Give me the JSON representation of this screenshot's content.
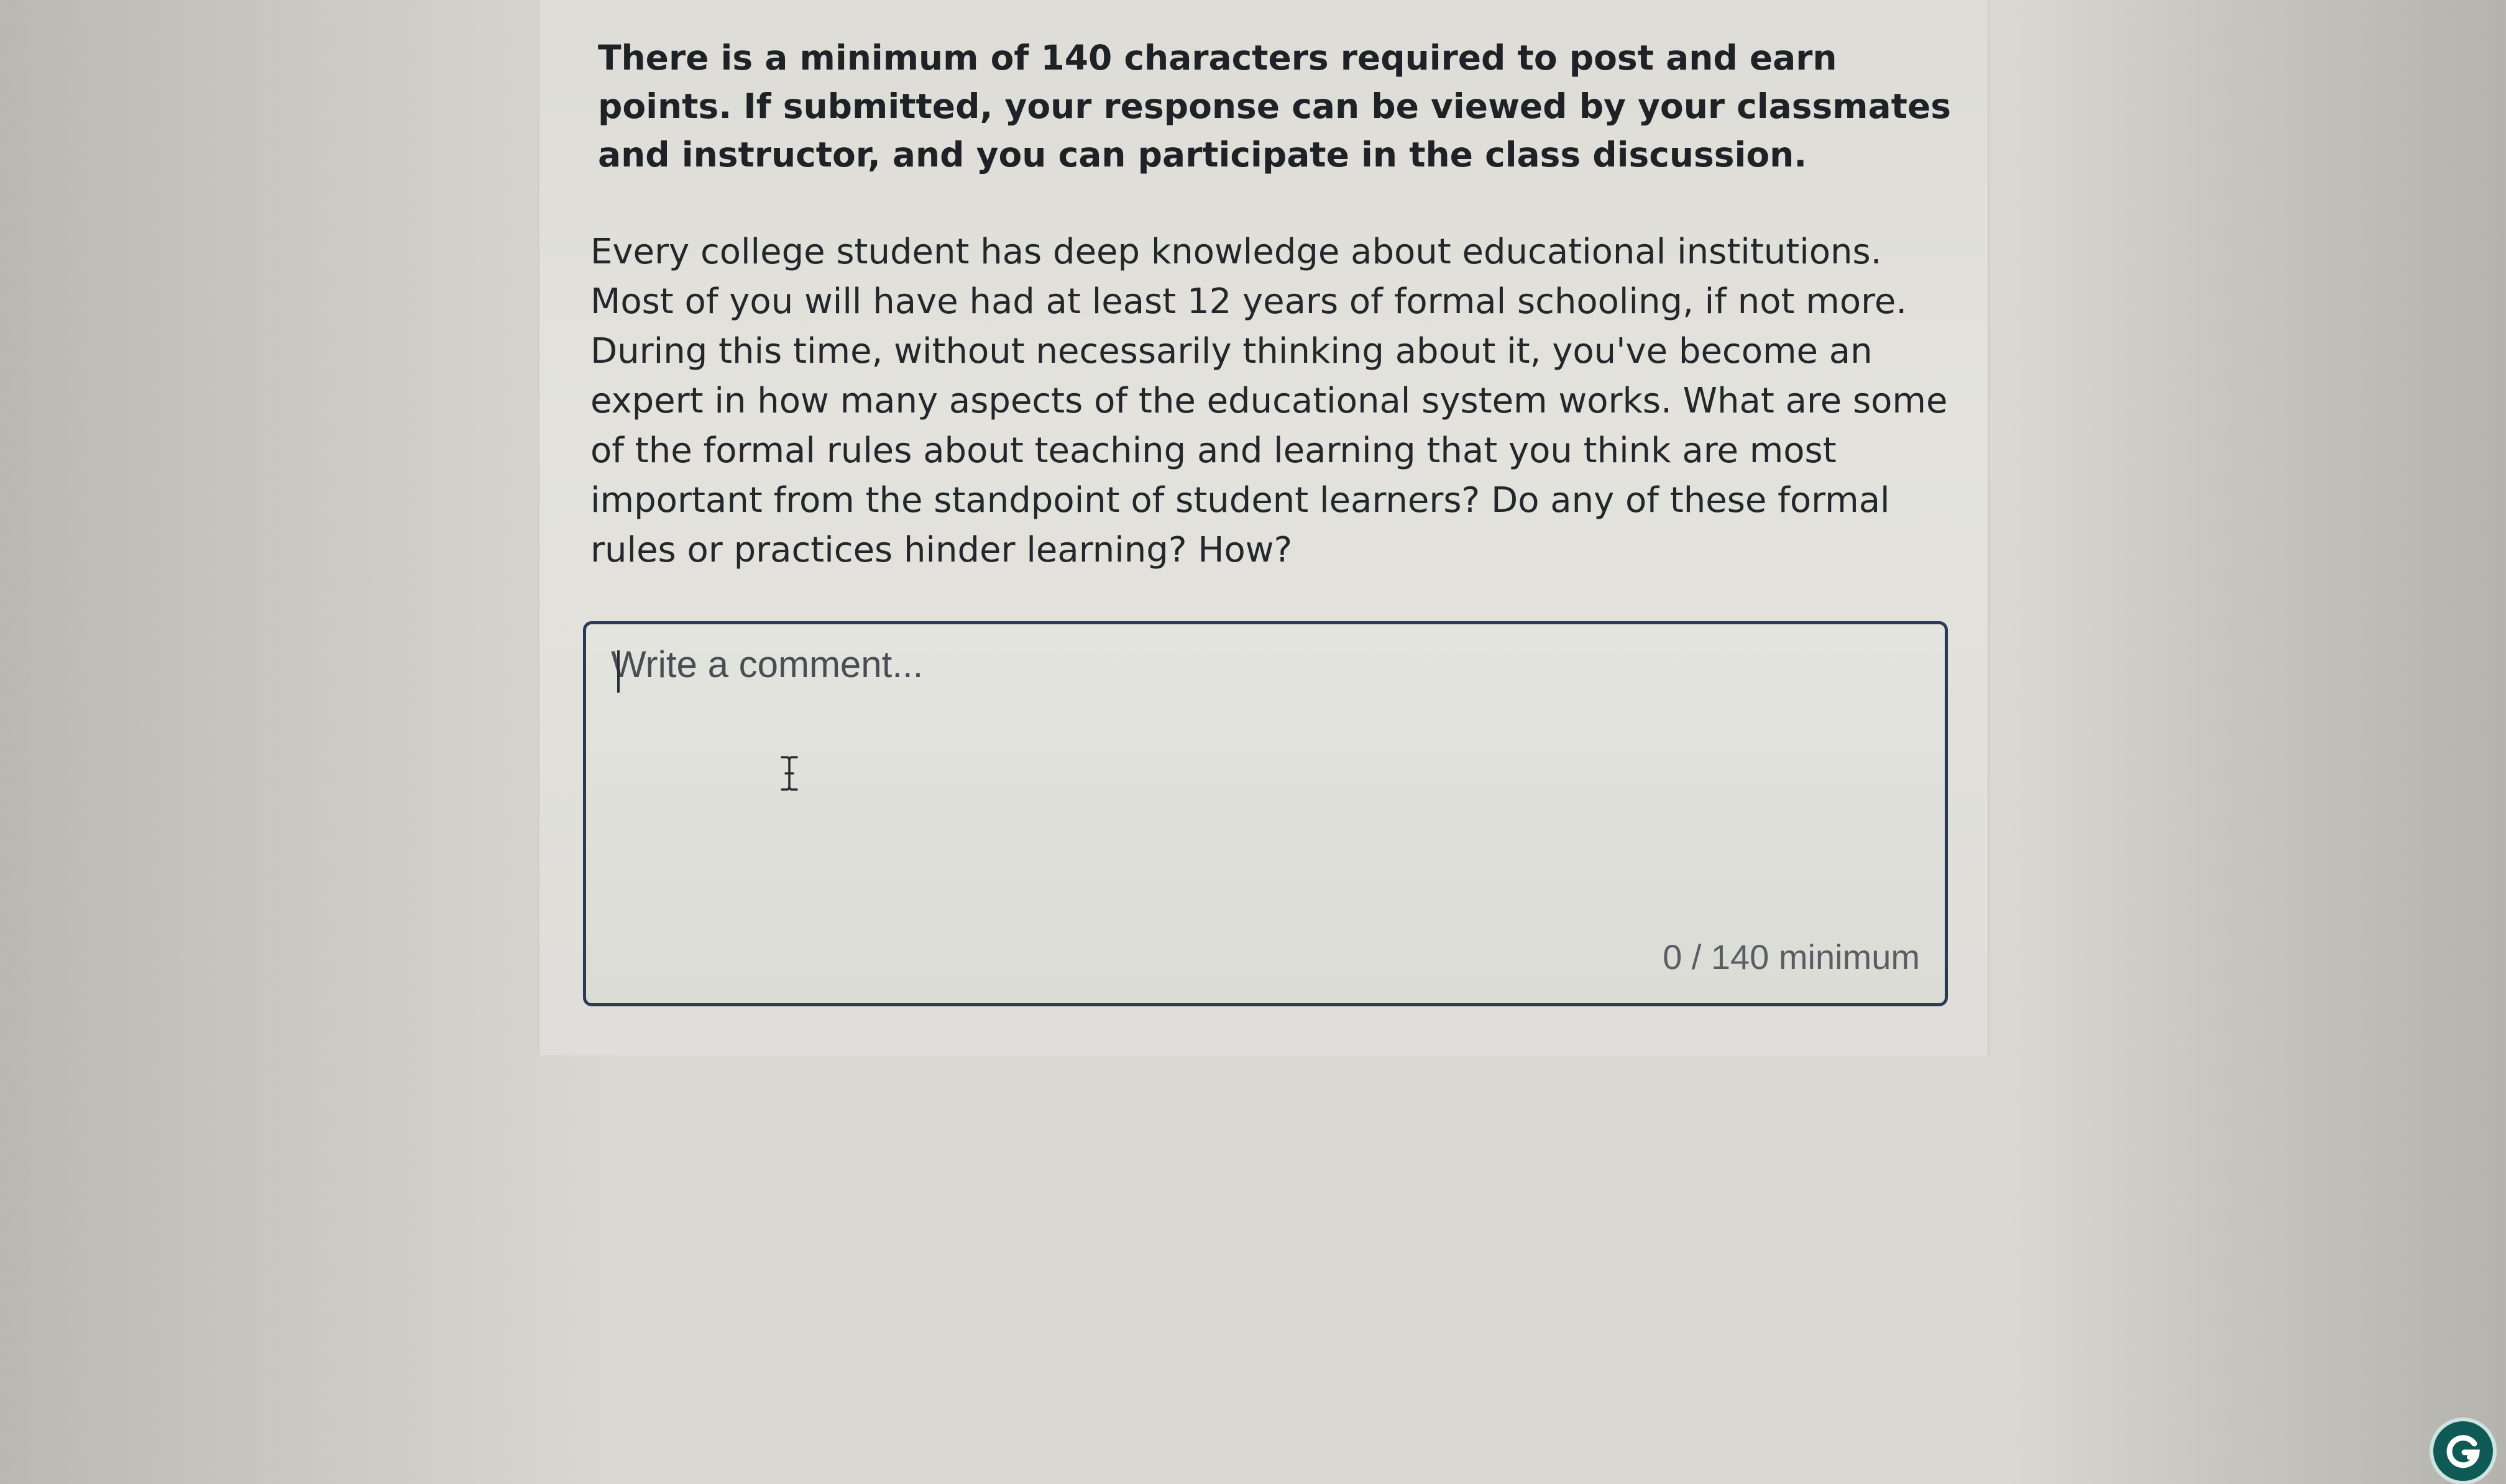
{
  "discussion": {
    "notice": "There is a minimum of 140 characters required to post and earn points. If submitted, your response can be viewed by your classmates and instructor, and you can participate in the class discussion.",
    "prompt": "Every college student has deep knowledge about educational institutions. Most of you will have had at least 12 years of formal schooling, if not more. During this time, without necessarily thinking about it, you've become an expert in how many aspects of the educational system works. What are some of the formal rules about teaching and learning that you think are most important from the standpoint of student learners? Do any of these formal rules or practices hinder learning? How?"
  },
  "comment": {
    "placeholder": "Write a comment...",
    "value": "",
    "counter": "0 / 140 minimum"
  },
  "icons": {
    "grammarly": "grammarly-g-icon",
    "cursor": "i-beam-cursor-icon"
  },
  "colors": {
    "box_border": "#2b3a55",
    "grammarly": "#0f5a55",
    "text": "#1e2226"
  }
}
